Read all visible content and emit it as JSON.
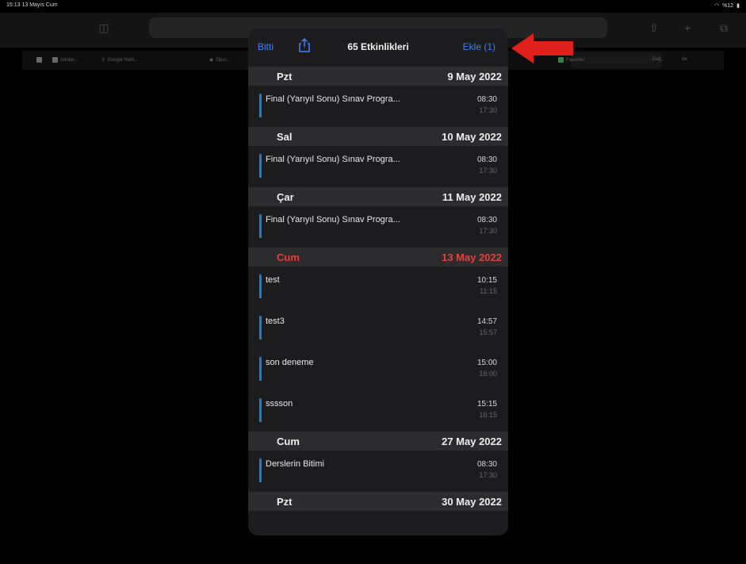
{
  "status_bar": {
    "time_date": "15:13  13 Mayıs Cum",
    "battery": "%12"
  },
  "bookmarks": [
    {
      "label": "Adobe...",
      "icon": "square-icon"
    },
    {
      "label": "Google Harit...",
      "icon": "location-icon"
    },
    {
      "label": "Opur...",
      "icon": "globe-icon"
    },
    {
      "label": "Favoriler",
      "icon": "square-icon"
    },
    {
      "label": "...Bağ...",
      "icon": "square-icon"
    },
    {
      "label": "de",
      "icon": "none"
    }
  ],
  "popover": {
    "done_label": "Bitti",
    "title": "65 Etkinlikleri",
    "add_label": "Ekle (1)",
    "days": [
      {
        "day": "Pzt",
        "date": "9 May 2022",
        "today": false,
        "events": [
          {
            "title": "Final (Yarıyıl Sonu) Sınav Progra...",
            "start": "08:30",
            "end": "17:30"
          }
        ]
      },
      {
        "day": "Sal",
        "date": "10 May 2022",
        "today": false,
        "events": [
          {
            "title": "Final (Yarıyıl Sonu) Sınav Progra...",
            "start": "08:30",
            "end": "17:30"
          }
        ]
      },
      {
        "day": "Çar",
        "date": "11 May 2022",
        "today": false,
        "events": [
          {
            "title": "Final (Yarıyıl Sonu) Sınav Progra...",
            "start": "08:30",
            "end": "17:30"
          }
        ]
      },
      {
        "day": "Cum",
        "date": "13 May 2022",
        "today": true,
        "events": [
          {
            "title": "test",
            "start": "10:15",
            "end": "11:15"
          },
          {
            "title": "test3",
            "start": "14:57",
            "end": "15:57"
          },
          {
            "title": "son deneme",
            "start": "15:00",
            "end": "16:00"
          },
          {
            "title": "sssson",
            "start": "15:15",
            "end": "16:15"
          }
        ]
      },
      {
        "day": "Cum",
        "date": "27 May 2022",
        "today": false,
        "events": [
          {
            "title": "Derslerin Bitimi",
            "start": "08:30",
            "end": "17:30"
          }
        ]
      },
      {
        "day": "Pzt",
        "date": "30 May 2022",
        "today": false,
        "events": []
      }
    ]
  },
  "colors": {
    "accent": "#3b82f6",
    "today": "#e0413b",
    "event_bar": "#1e7fc9",
    "annotation_arrow": "#e0201b"
  }
}
